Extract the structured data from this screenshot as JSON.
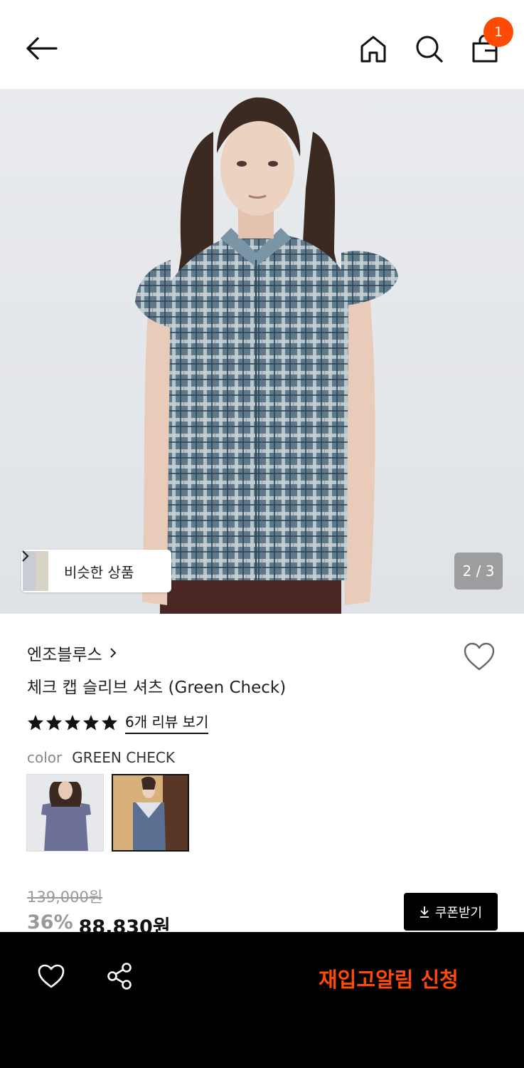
{
  "header": {
    "icons": [
      "back-arrow-icon",
      "home-icon",
      "search-icon",
      "shopping-bag-icon"
    ],
    "cart_count": "1"
  },
  "gallery": {
    "similar_label": "비슷한 상품",
    "page_indicator": "2 / 3"
  },
  "product": {
    "brand": "엔조블루스",
    "title": "체크 캡 슬리브 셔츠 (Green Check)",
    "rating_stars": 5,
    "review_link": "6개 리뷰 보기",
    "color_label": "color",
    "color_value": "GREEN CHECK",
    "original_price": "139,000원",
    "discount": "36%",
    "sale_price": "88,830원",
    "coupon_label": "쿠폰받기"
  },
  "bottom_bar": {
    "restock_label": "재입고알림 신청"
  },
  "colors": {
    "accent": "#ff4a05",
    "bottom_bar_bg": "#000000"
  }
}
